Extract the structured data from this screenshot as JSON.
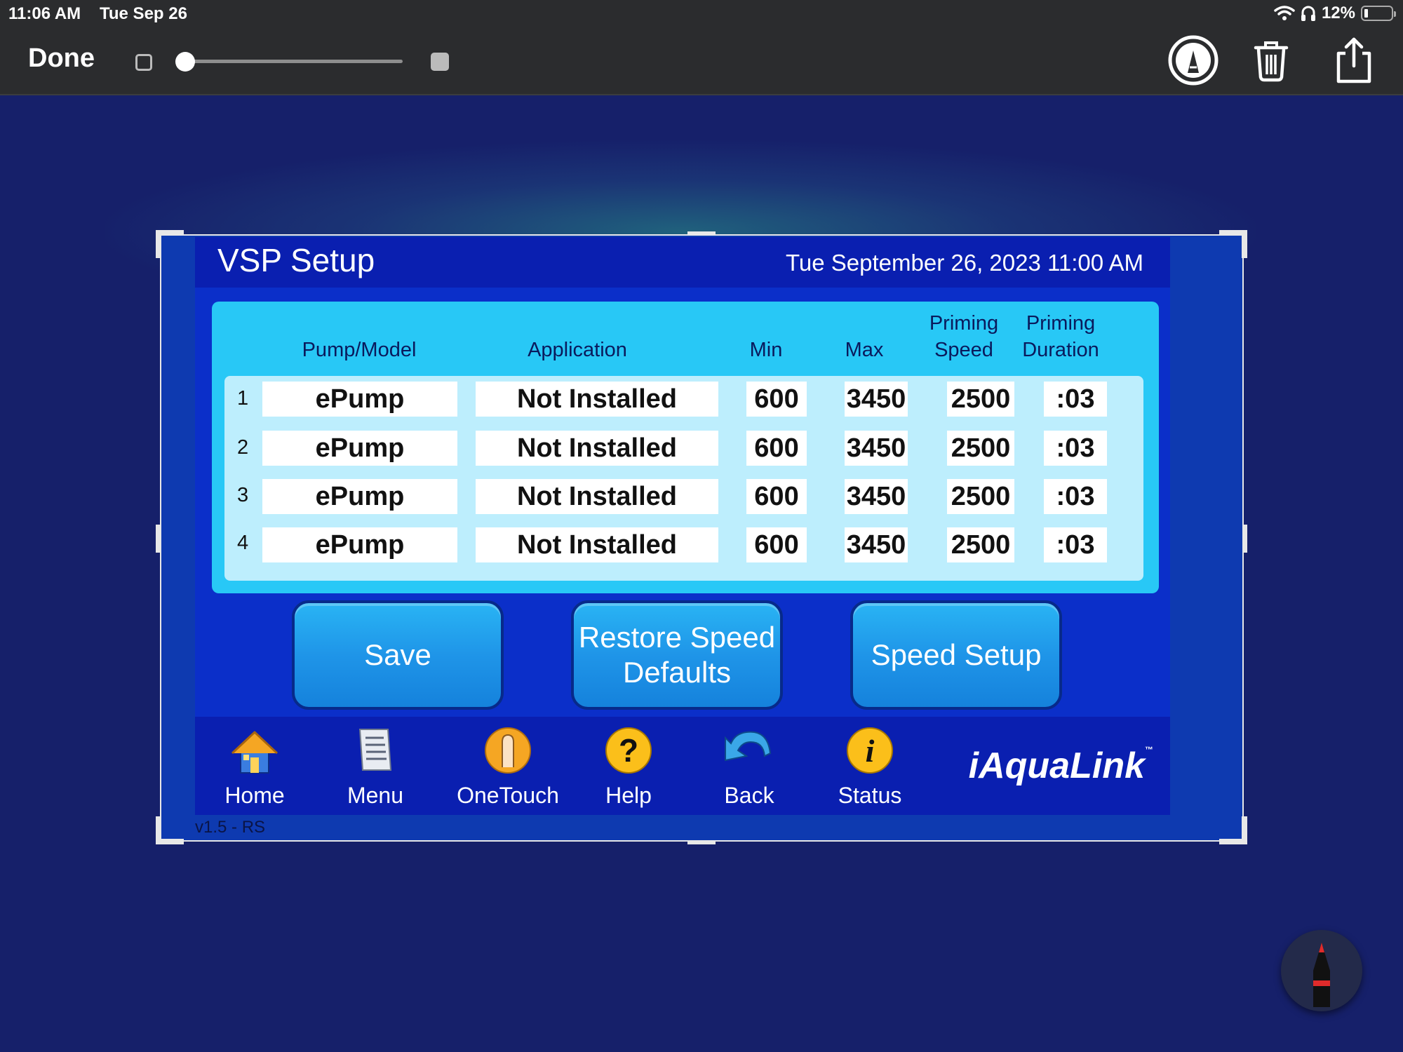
{
  "status_bar": {
    "time": "11:06 AM",
    "date": "Tue Sep 26",
    "battery": "12%"
  },
  "toolbar": {
    "done_label": "Done",
    "brush_size": 0
  },
  "app": {
    "title": "VSP Setup",
    "datetime": "Tue September 26, 2023 11:00 AM",
    "table": {
      "headers": {
        "pump_model": "Pump/Model",
        "application": "Application",
        "min": "Min",
        "max": "Max",
        "priming_speed_1": "Priming",
        "priming_speed_2": "Speed",
        "priming_duration_1": "Priming",
        "priming_duration_2": "Duration"
      },
      "rows": [
        {
          "num": "1",
          "pump": "ePump",
          "application": "Not Installed",
          "min": "600",
          "max": "3450",
          "priming_speed": "2500",
          "priming_duration": ":03"
        },
        {
          "num": "2",
          "pump": "ePump",
          "application": "Not Installed",
          "min": "600",
          "max": "3450",
          "priming_speed": "2500",
          "priming_duration": ":03"
        },
        {
          "num": "3",
          "pump": "ePump",
          "application": "Not Installed",
          "min": "600",
          "max": "3450",
          "priming_speed": "2500",
          "priming_duration": ":03"
        },
        {
          "num": "4",
          "pump": "ePump",
          "application": "Not Installed",
          "min": "600",
          "max": "3450",
          "priming_speed": "2500",
          "priming_duration": ":03"
        }
      ]
    },
    "buttons": {
      "save": "Save",
      "restore_line1": "Restore Speed",
      "restore_line2": "Defaults",
      "speed_setup": "Speed Setup"
    },
    "nav": {
      "home": "Home",
      "menu": "Menu",
      "onetouch": "OneTouch",
      "help": "Help",
      "back": "Back",
      "status": "Status"
    },
    "brand": "iAquaLink",
    "brand_tm": "™",
    "version": "v1.5 - RS"
  },
  "colors": {
    "app_bg": "#0b2fc9",
    "table_panel": "#28c8f6",
    "button": "#1f95e8"
  }
}
